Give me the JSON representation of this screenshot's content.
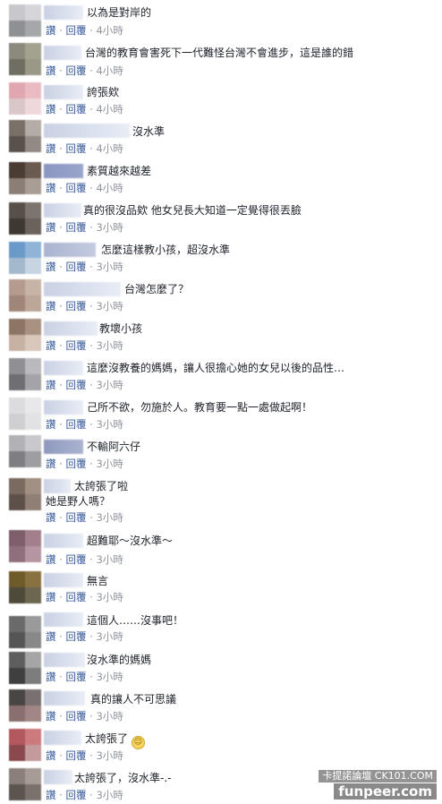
{
  "actions": {
    "like": "讚",
    "reply": "回覆",
    "separator": "·"
  },
  "comments": [
    {
      "text": "以為是對岸的",
      "time": "4小時"
    },
    {
      "text": "台灣的教育會害死下一代難怪台灣不會進步，這是誰的錯",
      "time": "4小時"
    },
    {
      "text": "誇張欸",
      "time": "4小時"
    },
    {
      "text": "沒水準",
      "time": "4小時"
    },
    {
      "text": "素質越來越差",
      "time": "4小時"
    },
    {
      "text": "真的很沒品欸 他女兒長大知道一定覺得很丟臉",
      "time": "3小時"
    },
    {
      "text": "怎麼這樣教小孩，超沒水準",
      "time": "3小時"
    },
    {
      "text": "台灣怎麼了？",
      "time": "3小時"
    },
    {
      "text": "教壞小孩",
      "time": "3小時"
    },
    {
      "text": "這麼沒教養的媽媽，讓人很擔心她的女兒以後的品性…",
      "time": "3小時"
    },
    {
      "text": "己所不欲，勿施於人。教育要一點一處做起啊！",
      "time": "3小時"
    },
    {
      "text": "不輸阿六仔",
      "time": "3小時"
    },
    {
      "text": "太誇張了啦",
      "text2": "她是野人嗎？",
      "time": "3小時"
    },
    {
      "text": "超難耶～沒水準～",
      "time": "3小時"
    },
    {
      "text": "無言",
      "time": "3小時"
    },
    {
      "text": "這個人……沒事吧！",
      "time": "3小時"
    },
    {
      "text": "沒水準的媽媽",
      "time": "3小時"
    },
    {
      "text": "真的讓人不可思議",
      "time": "3小時"
    },
    {
      "text": "太誇張了",
      "time": "3小時"
    },
    {
      "text": "太誇張了，沒水準-.-",
      "time": "3小時"
    }
  ],
  "watermark": {
    "line1": "卡提諾論壇 CK101.COM",
    "line2": "funpeer.com"
  }
}
